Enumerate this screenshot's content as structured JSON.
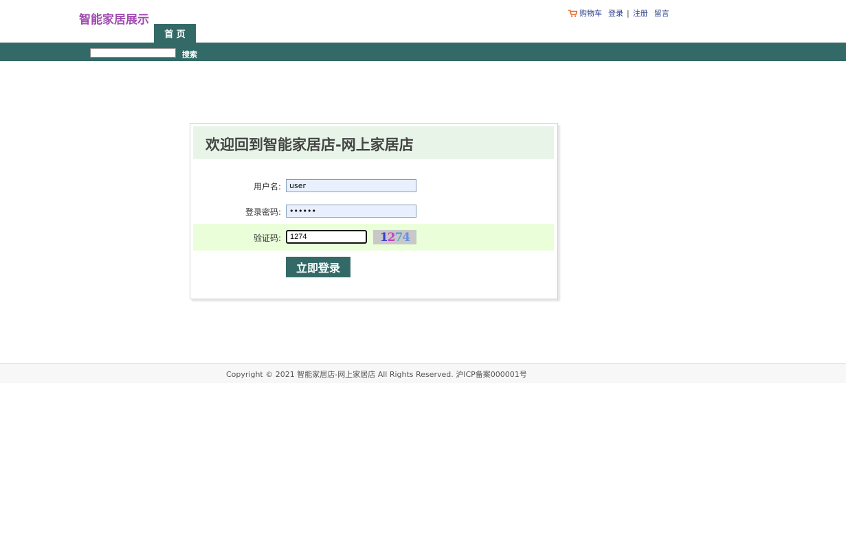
{
  "header": {
    "logo": "智能家居展示",
    "links": {
      "cart": "购物车",
      "login": "登录",
      "separator": "|",
      "register": "注册",
      "message": "留言"
    },
    "nav": {
      "home": "首 页"
    },
    "search": {
      "value": "",
      "button": "搜索"
    }
  },
  "login": {
    "title": "欢迎回到智能家居店-网上家居店",
    "username_label": "用户名:",
    "username_value": "user",
    "password_label": "登录密码:",
    "password_value": "••••••",
    "captcha_label": "验证码:",
    "captcha_value": "1274",
    "captcha_image_text": "1274",
    "submit": "立即登录"
  },
  "footer": {
    "copyright": "Copyright © 2021 智能家居店-网上家居店 All Rights Reserved. 沪ICP备案000001号"
  },
  "colors": {
    "brand": "#336a67",
    "logo": "#a04ab0",
    "link": "#2b3f8a",
    "header_panel": "#e8f4e8",
    "captcha_row": "#eaffd9"
  },
  "icons": [
    "cart-icon"
  ]
}
